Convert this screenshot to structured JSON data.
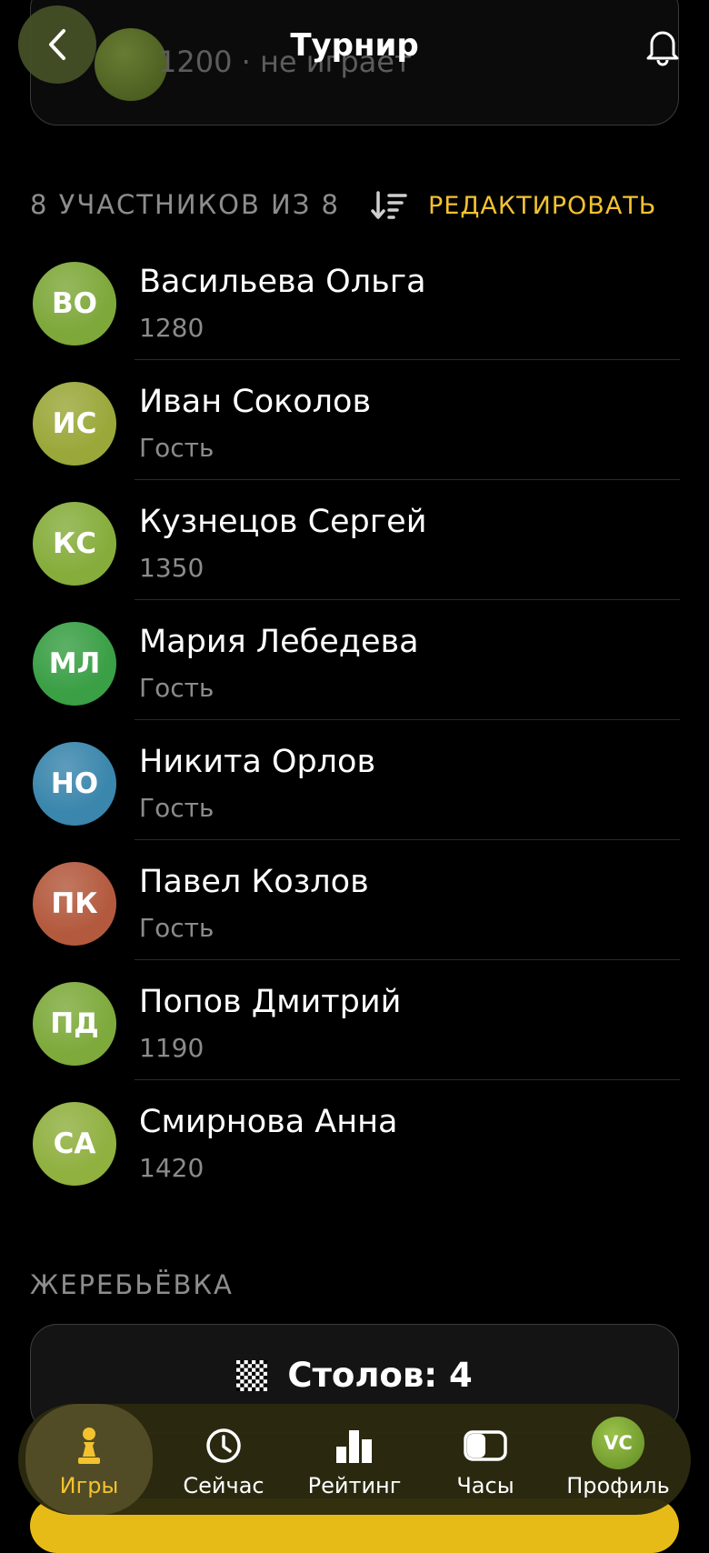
{
  "header": {
    "title": "Турнир",
    "back_icon": "chevron-left-icon",
    "bell_icon": "bell-icon"
  },
  "top_card": {
    "subtitle": "1200 · не играет"
  },
  "participants": {
    "heading": "8 УЧАСТНИКОВ ИЗ 8",
    "sort_icon": "sort-icon",
    "edit_label": "РЕДАКТИРОВАТЬ",
    "items": [
      {
        "initials": "ВО",
        "name": "Васильева Ольга",
        "sub": "1280",
        "color": "#7ea83a"
      },
      {
        "initials": "ИС",
        "name": "Иван Соколов",
        "sub": "Гость",
        "color": "#9aa83a"
      },
      {
        "initials": "КС",
        "name": "Кузнецов Сергей",
        "sub": "1350",
        "color": "#86ad3c"
      },
      {
        "initials": "МЛ",
        "name": "Мария Лебедева",
        "sub": "Гость",
        "color": "#3a9f45"
      },
      {
        "initials": "НО",
        "name": "Никита Орлов",
        "sub": "Гость",
        "color": "#3a86ac"
      },
      {
        "initials": "ПК",
        "name": "Павел Козлов",
        "sub": "Гость",
        "color": "#b35a3e"
      },
      {
        "initials": "ПД",
        "name": "Попов Дмитрий",
        "sub": "1190",
        "color": "#7eaa3c"
      },
      {
        "initials": "СА",
        "name": "Смирнова Анна",
        "sub": "1420",
        "color": "#90b040"
      }
    ]
  },
  "draw": {
    "heading": "ЖЕРЕБЬЁВКА",
    "tables_label": "Столов: 4",
    "tables_icon": "chessboard-icon"
  },
  "nav": {
    "items": [
      {
        "label": "Игры",
        "icon": "pawn-icon",
        "active": true
      },
      {
        "label": "Сейчас",
        "icon": "clock-icon"
      },
      {
        "label": "Рейтинг",
        "icon": "bar-chart-icon"
      },
      {
        "label": "Часы",
        "icon": "toggle-icon"
      },
      {
        "label": "Профиль",
        "icon": "avatar",
        "initials": "VC"
      }
    ]
  },
  "colors": {
    "accent": "#f2c230",
    "background": "#000000"
  }
}
